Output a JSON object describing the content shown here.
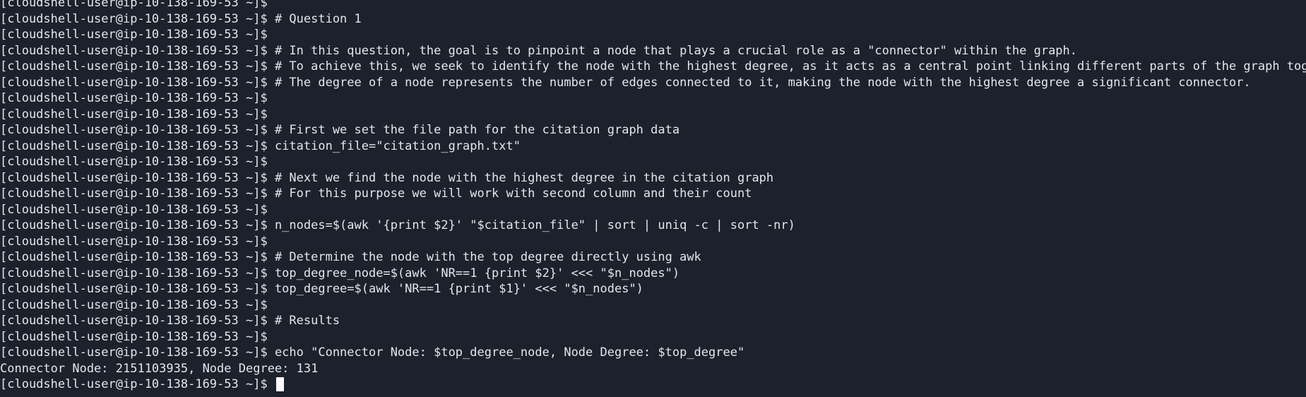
{
  "terminal": {
    "prompt": "[cloudshell-user@ip-10-138-169-53 ~]$",
    "lines": [
      {
        "prompt": true,
        "text": ""
      },
      {
        "prompt": true,
        "text": " # Question 1"
      },
      {
        "prompt": true,
        "text": ""
      },
      {
        "prompt": true,
        "text": " # In this question, the goal is to pinpoint a node that plays a crucial role as a \"connector\" within the graph."
      },
      {
        "prompt": true,
        "text": " # To achieve this, we seek to identify the node with the highest degree, as it acts as a central point linking different parts of the graph together."
      },
      {
        "prompt": true,
        "text": " # The degree of a node represents the number of edges connected to it, making the node with the highest degree a significant connector."
      },
      {
        "prompt": true,
        "text": ""
      },
      {
        "prompt": true,
        "text": ""
      },
      {
        "prompt": true,
        "text": " # First we set the file path for the citation graph data"
      },
      {
        "prompt": true,
        "text": " citation_file=\"citation_graph.txt\""
      },
      {
        "prompt": true,
        "text": ""
      },
      {
        "prompt": true,
        "text": " # Next we find the node with the highest degree in the citation graph"
      },
      {
        "prompt": true,
        "text": " # For this purpose we will work with second column and their count"
      },
      {
        "prompt": true,
        "text": ""
      },
      {
        "prompt": true,
        "text": " n_nodes=$(awk '{print $2}' \"$citation_file\" | sort | uniq -c | sort -nr)"
      },
      {
        "prompt": true,
        "text": ""
      },
      {
        "prompt": true,
        "text": " # Determine the node with the top degree directly using awk"
      },
      {
        "prompt": true,
        "text": " top_degree_node=$(awk 'NR==1 {print $2}' <<< \"$n_nodes\")"
      },
      {
        "prompt": true,
        "text": " top_degree=$(awk 'NR==1 {print $1}' <<< \"$n_nodes\")"
      },
      {
        "prompt": true,
        "text": ""
      },
      {
        "prompt": true,
        "text": " # Results"
      },
      {
        "prompt": true,
        "text": ""
      },
      {
        "prompt": true,
        "text": " echo \"Connector Node: $top_degree_node, Node Degree: $top_degree\""
      },
      {
        "prompt": false,
        "text": "Connector Node: 2151103935, Node Degree: 131"
      },
      {
        "prompt": true,
        "text": " ",
        "cursor": true
      }
    ]
  }
}
